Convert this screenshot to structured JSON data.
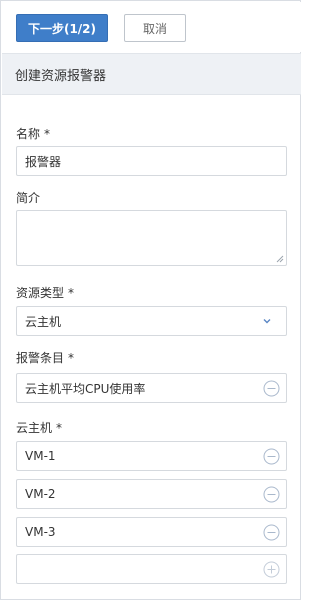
{
  "toolbar": {
    "next_label": "下一步(1/2)",
    "cancel_label": "取消"
  },
  "form": {
    "title": "创建资源报警器",
    "name_label": "名称",
    "name_value": "报警器",
    "desc_label": "简介",
    "desc_value": "",
    "resource_type_label": "资源类型",
    "resource_type_value": "云主机",
    "alarm_item_label": "报警条目",
    "alarm_item_value": "云主机平均CPU使用率",
    "vm_label": "云主机",
    "vm_items": [
      "VM-1",
      "VM-2",
      "VM-3"
    ],
    "required_mark": "*"
  },
  "icons": {
    "remove": "minus-circle-icon",
    "add": "plus-circle-icon",
    "dropdown": "chevron-down-icon"
  },
  "colors": {
    "primary": "#3f7ec9",
    "header_bg": "#eef1f5",
    "icon": "#8fa6c8",
    "border": "#d5d9de"
  }
}
